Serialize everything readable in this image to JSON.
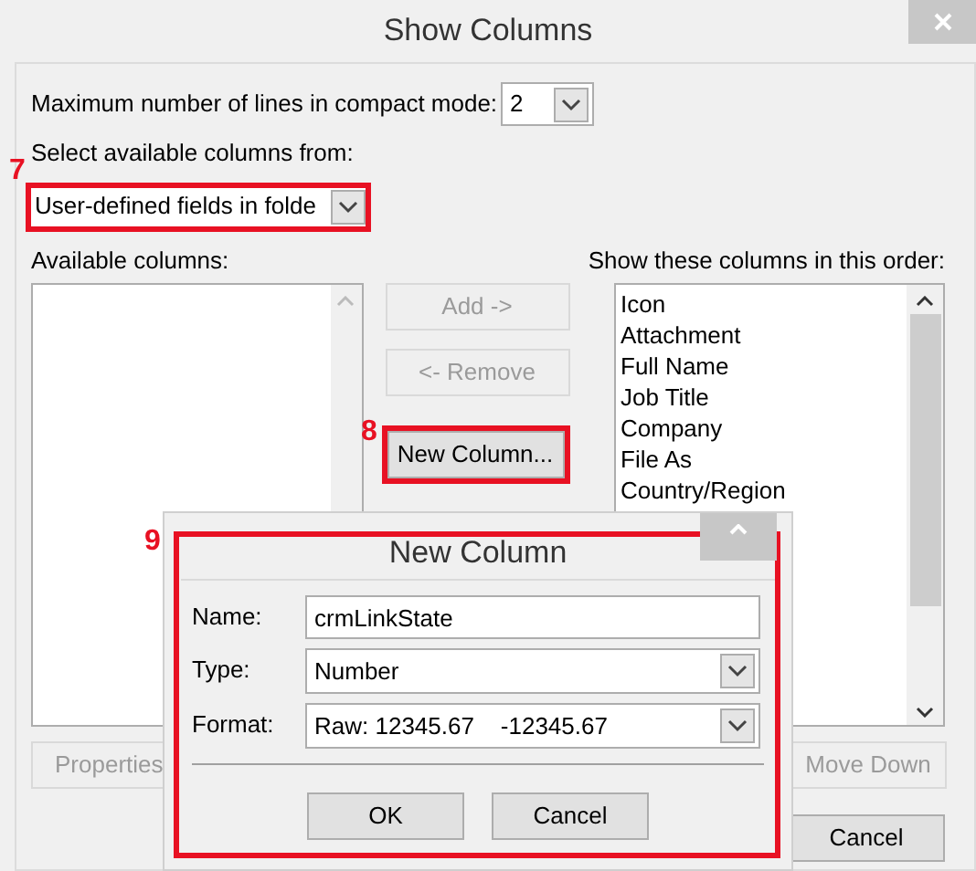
{
  "window": {
    "title": "Show Columns"
  },
  "compact_lines": {
    "label": "Maximum number of lines in compact mode:",
    "value": "2"
  },
  "source": {
    "label": "Select available columns from:",
    "value": "User-defined fields in folde",
    "annotation": "7"
  },
  "available": {
    "label": "Available columns:"
  },
  "shown": {
    "label": "Show these columns in this order:",
    "items": [
      "Icon",
      "Attachment",
      "Full Name",
      "Job Title",
      "Company",
      "File As",
      "Country/Region"
    ]
  },
  "middle_buttons": [
    {
      "label": "Add ->",
      "disabled": true
    },
    {
      "label": "<- Remove",
      "disabled": true
    },
    {
      "label": "New Column...",
      "disabled": false,
      "annotation": "8"
    }
  ],
  "lower_buttons": [
    {
      "label": "Properties",
      "disabled": true
    },
    {
      "label": "Move Down",
      "disabled": true
    }
  ],
  "footer_buttons": [
    {
      "label": "Cancel",
      "disabled": false
    }
  ],
  "new_column_dialog": {
    "title": "New Column",
    "annotation": "9",
    "fields": [
      {
        "kind": "text",
        "label": "Name:",
        "value": "crmLinkState"
      },
      {
        "kind": "select",
        "label": "Type:",
        "value": "Number"
      },
      {
        "kind": "select",
        "label": "Format:",
        "value": "Raw: 12345.67    -12345.67"
      }
    ],
    "buttons": [
      "OK",
      "Cancel"
    ]
  }
}
